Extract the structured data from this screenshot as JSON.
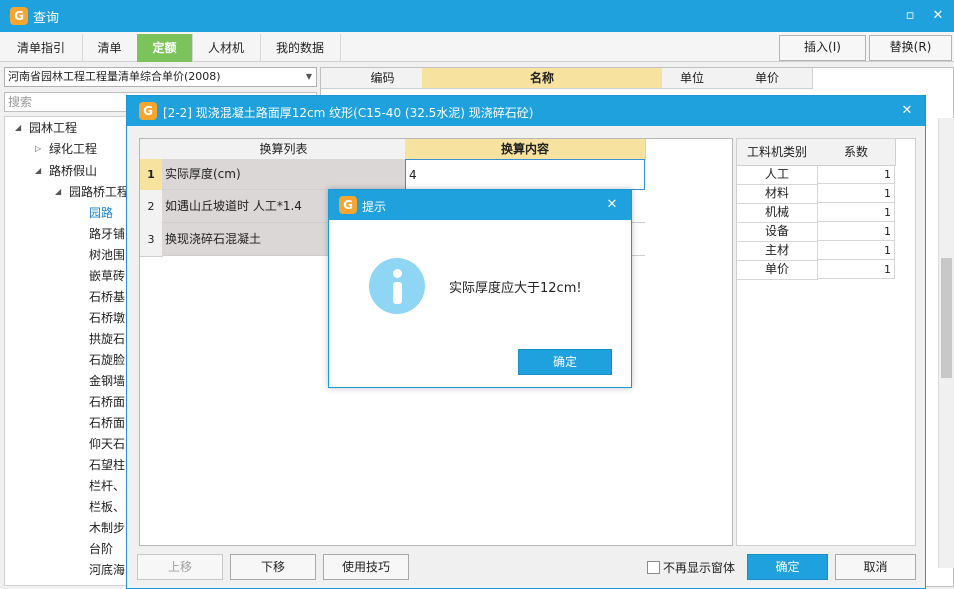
{
  "window": {
    "title": "查询",
    "minimize_icon": "minimize-icon",
    "close_icon": "close-icon"
  },
  "tabs": [
    {
      "label": "清单指引"
    },
    {
      "label": "清单"
    },
    {
      "label": "定额",
      "active": true
    },
    {
      "label": "人材机"
    },
    {
      "label": "我的数据"
    }
  ],
  "toolbar": {
    "insert_label": "插入(I)",
    "replace_label": "替换(R)"
  },
  "left": {
    "library": "河南省园林工程工程量清单综合单价(2008)",
    "search_placeholder": "搜索",
    "tree": [
      {
        "label": "园林工程",
        "level": 0,
        "expanded": true
      },
      {
        "label": "绿化工程",
        "level": 1,
        "expanded": false
      },
      {
        "label": "路桥假山",
        "level": 1,
        "expanded": true
      },
      {
        "label": "园路桥工程",
        "level": 2,
        "expanded": true
      },
      {
        "label": "园路",
        "level": 3,
        "selected": true
      },
      {
        "label": "路牙铺",
        "level": 3
      },
      {
        "label": "树池围",
        "level": 3
      },
      {
        "label": "嵌草砖",
        "level": 3
      },
      {
        "label": "石桥基",
        "level": 3
      },
      {
        "label": "石桥墩",
        "level": 3
      },
      {
        "label": "拱旋石",
        "level": 3
      },
      {
        "label": "石旋脸",
        "level": 3
      },
      {
        "label": "金钢墙",
        "level": 3
      },
      {
        "label": "石桥面",
        "level": 3
      },
      {
        "label": "石桥面",
        "level": 3
      },
      {
        "label": "仰天石",
        "level": 3
      },
      {
        "label": "石望柱",
        "level": 3
      },
      {
        "label": "栏杆、",
        "level": 3
      },
      {
        "label": "栏板、",
        "level": 3
      },
      {
        "label": "木制步",
        "level": 3
      },
      {
        "label": "台阶",
        "level": 3
      },
      {
        "label": "河底海",
        "level": 3
      }
    ]
  },
  "bg_grid": {
    "headers": [
      "编码",
      "名称",
      "单位",
      "单价"
    ]
  },
  "dialog": {
    "title": "[2-2] 现浇混凝土路面厚12cm 纹形(C15-40 (32.5水泥) 现浇碎石砼)",
    "close_icon": "close-icon",
    "left_grid": {
      "headers": [
        "换算列表",
        "换算内容"
      ],
      "rows": [
        {
          "num": "1",
          "item": "实际厚度(cm)",
          "value": "4"
        },
        {
          "num": "2",
          "item": "如遇山丘坡道时 人工*1.4",
          "value": ""
        },
        {
          "num": "3",
          "item": "换现浇碎石混凝土",
          "value": ""
        }
      ]
    },
    "right_grid": {
      "headers": [
        "工料机类别",
        "系数"
      ],
      "rows": [
        {
          "type": "人工",
          "coef": "1"
        },
        {
          "type": "材料",
          "coef": "1"
        },
        {
          "type": "机械",
          "coef": "1"
        },
        {
          "type": "设备",
          "coef": "1"
        },
        {
          "type": "主材",
          "coef": "1"
        },
        {
          "type": "单价",
          "coef": "1"
        }
      ]
    },
    "buttons": {
      "up": "上移",
      "down": "下移",
      "tips": "使用技巧",
      "no_show": "不再显示窗体",
      "ok": "确定",
      "cancel": "取消"
    }
  },
  "prompt": {
    "title": "提示",
    "message": "实际厚度应大于12cm!",
    "ok": "确定",
    "icon": "info-icon",
    "close_icon": "close-icon"
  },
  "colors": {
    "accent": "#1ea1dd",
    "active_tab": "#7dc35b",
    "header_highlight": "#f8e2a0"
  }
}
